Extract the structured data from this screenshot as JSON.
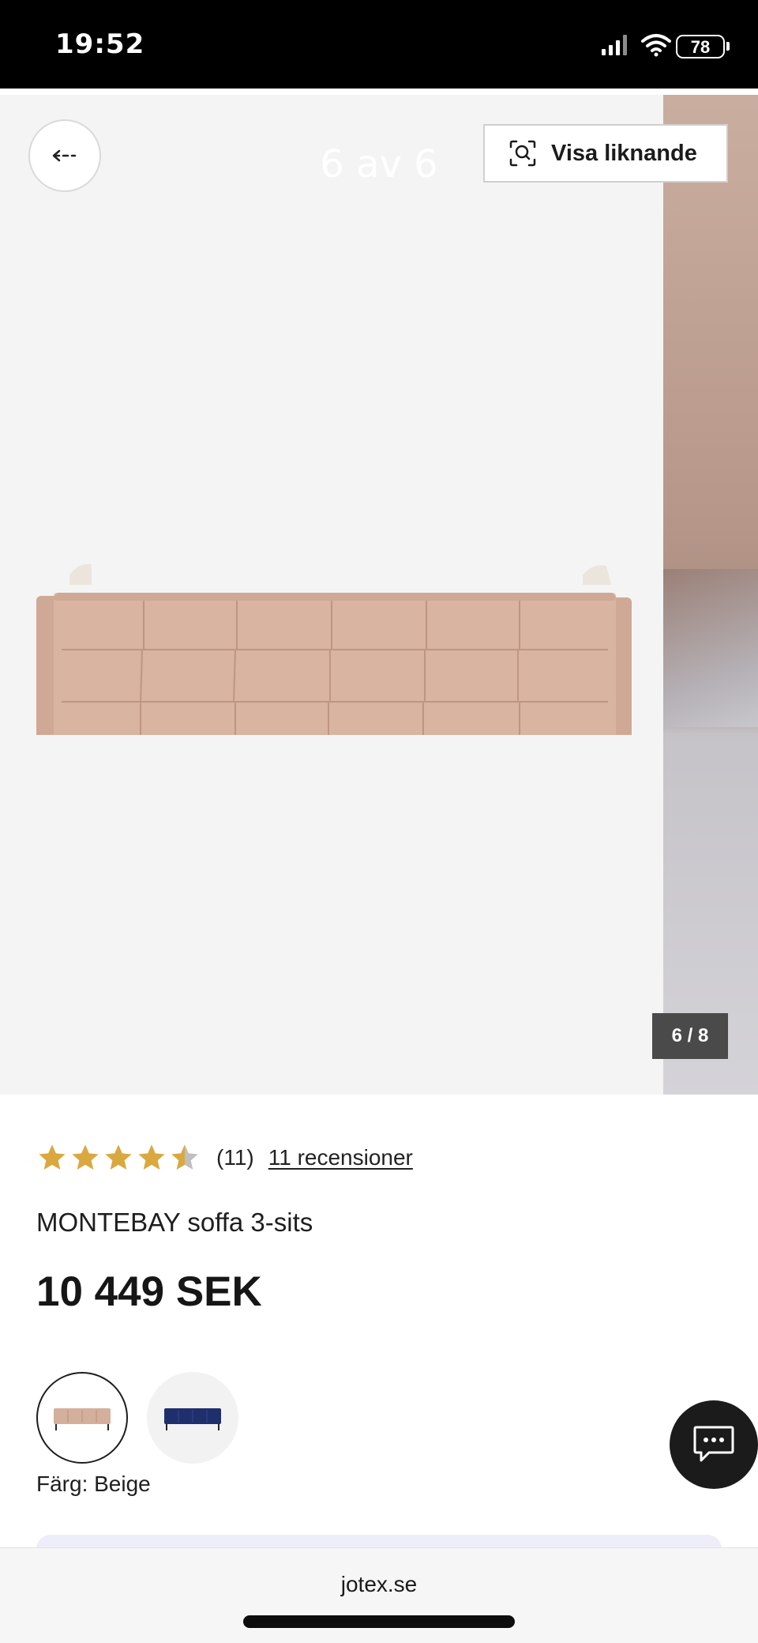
{
  "status_bar": {
    "time": "19:52",
    "battery": "78"
  },
  "gallery": {
    "position_text": "6 av 6",
    "similar_button_label": "Visa liknande",
    "image_index": "6 / 8"
  },
  "product": {
    "rating": 4.5,
    "rating_count": "(11)",
    "reviews_link": "11 recensioner",
    "title": "MONTEBAY soffa 3-sits",
    "price": "10 449 SEK",
    "color_label": "Färg: Beige",
    "colors": [
      "Beige",
      "Blue"
    ]
  },
  "browser": {
    "url": "jotex.se"
  },
  "colors": {
    "star_gold": "#d9a93f",
    "star_empty": "#bfbfbf",
    "sofa_beige": "#d4b09c",
    "sofa_blue": "#1f2f6e"
  }
}
